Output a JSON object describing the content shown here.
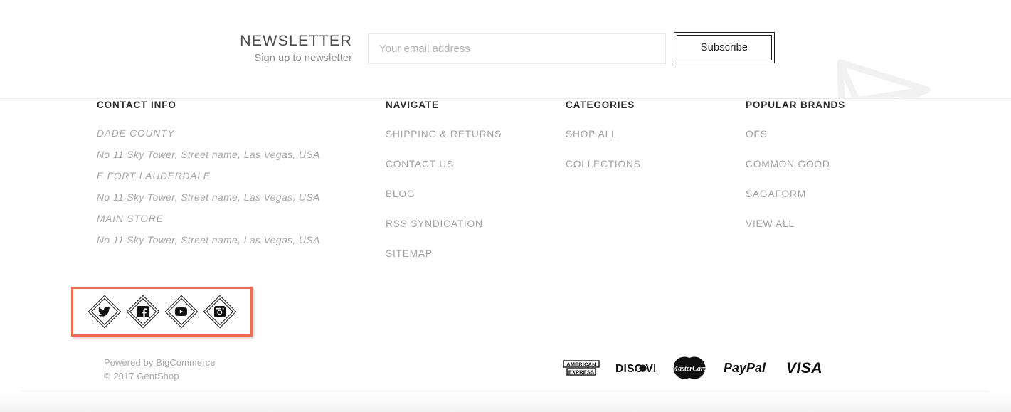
{
  "newsletter": {
    "title": "NEWSLETTER",
    "subtitle": "Sign up to newsletter",
    "email_placeholder": "Your email address",
    "email_value": "",
    "subscribe_label": "Subscribe",
    "decoration_icon": "paper-plane-icon"
  },
  "footer": {
    "contact": {
      "title": "CONTACT INFO",
      "lines": [
        "DADE COUNTY",
        "No 11 Sky Tower, Street name, Las Vegas, USA",
        "E FORT LAUDERDALE",
        "No 11 Sky Tower, Street name, Las Vegas, USA",
        "MAIN STORE",
        "No 11 Sky Tower, Street name, Las Vegas, USA"
      ]
    },
    "navigate": {
      "title": "NAVIGATE",
      "links": [
        "SHIPPING & RETURNS",
        "CONTACT US",
        "BLOG",
        "RSS SYNDICATION",
        "SITEMAP"
      ]
    },
    "categories": {
      "title": "CATEGORIES",
      "links": [
        "SHOP ALL",
        "COLLECTIONS"
      ]
    },
    "brands": {
      "title": "POPULAR BRANDS",
      "links": [
        "OFS",
        "COMMON GOOD",
        "SAGAFORM",
        "VIEW ALL"
      ]
    },
    "social": {
      "items": [
        {
          "name": "twitter-icon",
          "label": "Twitter"
        },
        {
          "name": "facebook-icon",
          "label": "Facebook"
        },
        {
          "name": "youtube-icon",
          "label": "YouTube"
        },
        {
          "name": "instagram-icon",
          "label": "Instagram"
        }
      ],
      "highlight_color": "#ef6b54"
    },
    "credits": {
      "powered_by": "Powered by BigCommerce",
      "copyright": "© 2017 GentShop"
    },
    "payments": [
      {
        "name": "american-express-icon",
        "label": "American Express"
      },
      {
        "name": "discover-icon",
        "label": "Discover"
      },
      {
        "name": "mastercard-icon",
        "label": "MasterCard"
      },
      {
        "name": "paypal-icon",
        "label": "PayPal"
      },
      {
        "name": "visa-icon",
        "label": "VISA"
      }
    ]
  },
  "colors": {
    "accent": "#ef6b54",
    "heading": "#2b2b2b",
    "muted": "#a2a2a2",
    "border": "#e9e9e9"
  }
}
